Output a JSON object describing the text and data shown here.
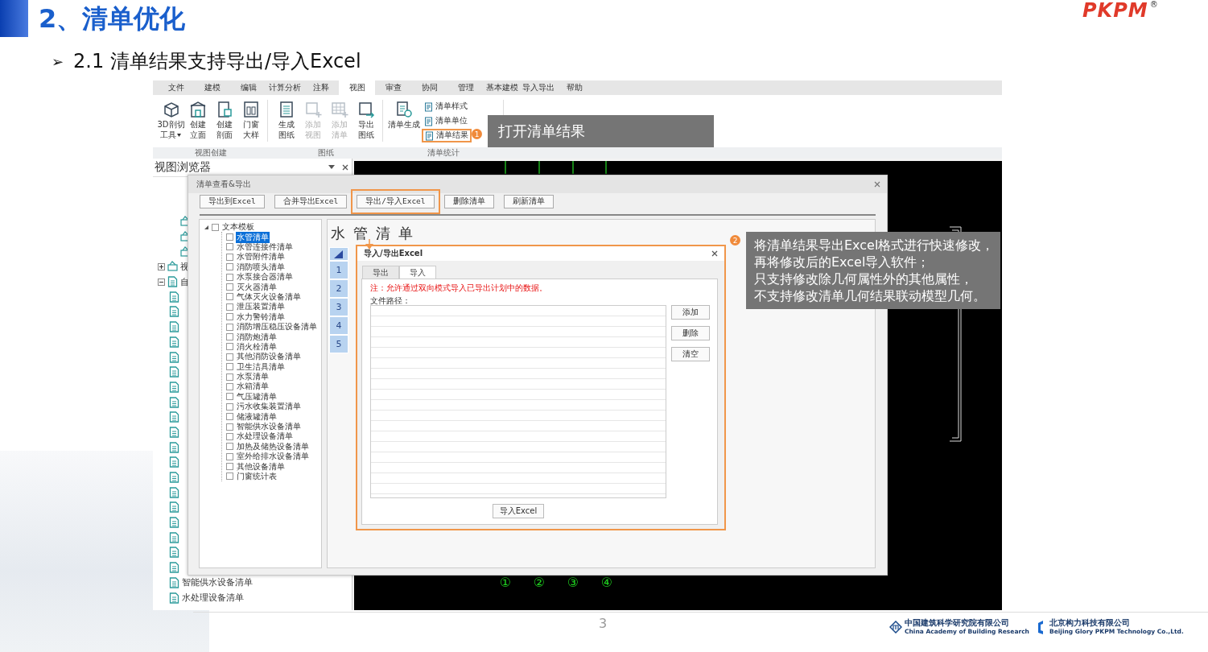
{
  "slide": {
    "title": "2、清单优化",
    "logo": "PKPM",
    "logo_mark": "®",
    "bullet": "➢",
    "subtitle": "2.1 清单结果支持导出/导入Excel",
    "page_number": "3"
  },
  "menu_tabs": [
    {
      "label": "文件",
      "selected": false
    },
    {
      "label": "建模",
      "selected": false
    },
    {
      "label": "编辑",
      "selected": false
    },
    {
      "label": "计算分析",
      "selected": false
    },
    {
      "label": "注释",
      "selected": false
    },
    {
      "label": "视图",
      "selected": true
    },
    {
      "label": "审查",
      "selected": false
    },
    {
      "label": "协同",
      "selected": false
    },
    {
      "label": "管理",
      "selected": false
    },
    {
      "label": "基本建模",
      "selected": false
    },
    {
      "label": "导入导出",
      "selected": false
    },
    {
      "label": "帮助",
      "selected": false
    }
  ],
  "ribbon": {
    "groups": [
      {
        "label": "视图创建",
        "tools": [
          {
            "lines": [
              "3D剖切",
              "工具"
            ],
            "dropdown": true,
            "disabled": false
          },
          {
            "lines": [
              "创建",
              "立面"
            ],
            "dropdown": false,
            "disabled": false
          },
          {
            "lines": [
              "创建",
              "剖面"
            ],
            "dropdown": false,
            "disabled": false
          },
          {
            "lines": [
              "门窗",
              "大样"
            ],
            "dropdown": false,
            "disabled": false
          }
        ]
      },
      {
        "label": "图纸",
        "tools": [
          {
            "lines": [
              "生成",
              "图纸"
            ],
            "dropdown": false,
            "disabled": false
          },
          {
            "lines": [
              "添加",
              "视图"
            ],
            "dropdown": false,
            "disabled": true
          },
          {
            "lines": [
              "添加",
              "清单"
            ],
            "dropdown": false,
            "disabled": true
          },
          {
            "lines": [
              "导出",
              "图纸"
            ],
            "dropdown": false,
            "disabled": false
          }
        ]
      },
      {
        "label": "清单统计",
        "tools": [
          {
            "lines": [
              "清单生成"
            ],
            "dropdown": false,
            "disabled": false
          }
        ],
        "small_tools": [
          {
            "label": "清单样式",
            "highlighted": false
          },
          {
            "label": "清单单位",
            "highlighted": false
          },
          {
            "label": "清单结果",
            "highlighted": true
          }
        ]
      }
    ]
  },
  "callouts": [
    {
      "number": "1",
      "lines": [
        "打开清单结果"
      ]
    },
    {
      "number": "2",
      "lines": [
        "将清单结果导出Excel格式进行快速修改，",
        "再将修改后的Excel导入软件；",
        "只支持修改除几何属性外的其他属性，",
        "不支持修改清单几何结果联动模型几何。"
      ]
    }
  ],
  "browser": {
    "title": "视图浏览器",
    "nodes": [
      {
        "label": "视",
        "expanded": false
      },
      {
        "label": "自",
        "expanded": true
      }
    ],
    "bottom_items": [
      "智能供水设备清单",
      "水处理设备清单"
    ]
  },
  "canvas": {
    "axis_labels": [
      "①",
      "②",
      "③",
      "④"
    ]
  },
  "list_dialog": {
    "title": "清单查看&导出",
    "buttons": [
      {
        "label": "导出到Excel",
        "highlighted": false
      },
      {
        "label": "合并导出Excel",
        "highlighted": false
      },
      {
        "label": "导出/导入Excel",
        "highlighted": true
      },
      {
        "label": "删除清单",
        "highlighted": false
      },
      {
        "label": "刷新清单",
        "highlighted": false
      }
    ],
    "tree": {
      "label": "文本模板",
      "checked": false,
      "expanded": true,
      "children": [
        {
          "label": "水管清单",
          "checked": false,
          "selected": true
        },
        {
          "label": "水管连接件清单",
          "checked": false,
          "selected": false
        },
        {
          "label": "水管附件清单",
          "checked": false,
          "selected": false
        },
        {
          "label": "消防喷头清单",
          "checked": false,
          "selected": false
        },
        {
          "label": "水泵接合器清单",
          "checked": false,
          "selected": false
        },
        {
          "label": "灭火器清单",
          "checked": false,
          "selected": false
        },
        {
          "label": "气体灭火设备清单",
          "checked": false,
          "selected": false
        },
        {
          "label": "泄压装置清单",
          "checked": false,
          "selected": false
        },
        {
          "label": "水力警铃清单",
          "checked": false,
          "selected": false
        },
        {
          "label": "消防增压稳压设备清单",
          "checked": false,
          "selected": false
        },
        {
          "label": "消防炮清单",
          "checked": false,
          "selected": false
        },
        {
          "label": "消火栓清单",
          "checked": false,
          "selected": false
        },
        {
          "label": "其他消防设备清单",
          "checked": false,
          "selected": false
        },
        {
          "label": "卫生洁具清单",
          "checked": false,
          "selected": false
        },
        {
          "label": "水泵清单",
          "checked": false,
          "selected": false
        },
        {
          "label": "水箱清单",
          "checked": false,
          "selected": false
        },
        {
          "label": "气压罐清单",
          "checked": false,
          "selected": false
        },
        {
          "label": "污水收集装置清单",
          "checked": false,
          "selected": false
        },
        {
          "label": "储液罐清单",
          "checked": false,
          "selected": false
        },
        {
          "label": "智能供水设备清单",
          "checked": false,
          "selected": false
        },
        {
          "label": "水处理设备清单",
          "checked": false,
          "selected": false
        },
        {
          "label": "加热及储热设备清单",
          "checked": false,
          "selected": false
        },
        {
          "label": "室外给排水设备清单",
          "checked": false,
          "selected": false
        },
        {
          "label": "其他设备清单",
          "checked": false,
          "selected": false
        },
        {
          "label": "门窗统计表",
          "checked": false,
          "selected": false
        }
      ]
    },
    "table_title": "水管清单",
    "row_headers": [
      "1",
      "2",
      "3",
      "4",
      "5"
    ]
  },
  "excel_dialog": {
    "title": "导入/导出Excel",
    "tabs": [
      {
        "label": "导出",
        "selected": false
      },
      {
        "label": "导入",
        "selected": true
      }
    ],
    "note": "注：允许通过双向模式导入已导出计划中的数据。",
    "path_label": "文件路径：",
    "side_buttons": [
      "添加",
      "删除",
      "清空"
    ],
    "import_button": "导入Excel"
  },
  "footer": {
    "org1": "中国建筑科学研究院有限公司",
    "org1_en": "China Academy of Building Research",
    "org2": "北京构力科技有限公司",
    "org2_en": "Beijing Glory PKPM Technology Co.,Ltd."
  }
}
